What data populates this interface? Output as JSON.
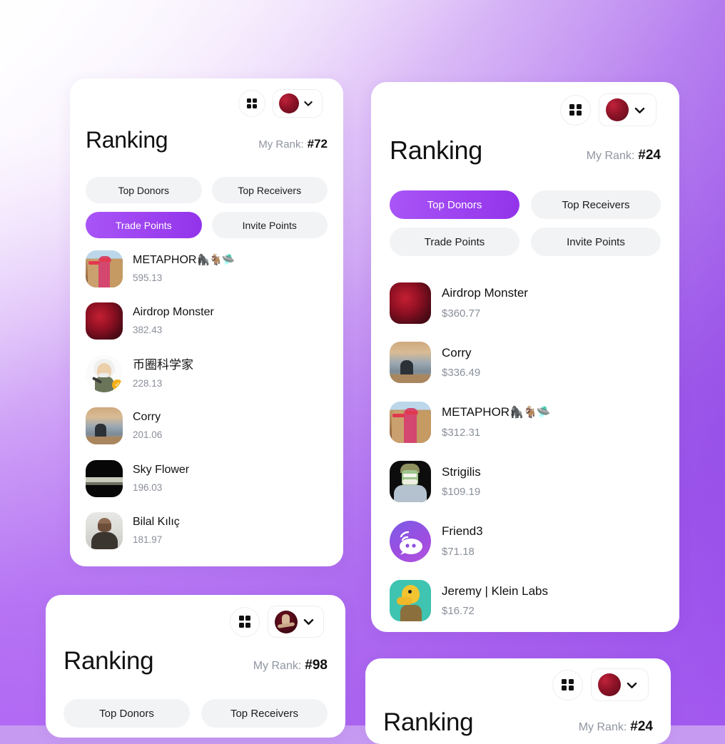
{
  "theme": {
    "accent": "#9333ea",
    "accent_light": "#a855f7",
    "pill_bg": "#f2f3f5",
    "text": "#111111",
    "muted": "#8a8f9a",
    "bg_from": "#fdfbff",
    "bg_to": "#b66ff5"
  },
  "cards": [
    {
      "id": "card-top-left",
      "title": "Ranking",
      "rank_label": "My Rank:",
      "rank_value": "#72",
      "grid_icon": "grid-icon",
      "chevron_icon": "chevron-down-icon",
      "avatar_name": "account-avatar",
      "tabs": [
        {
          "label": "Top Donors",
          "active": false
        },
        {
          "label": "Top Receivers",
          "active": false
        },
        {
          "label": "Trade Points",
          "active": true
        },
        {
          "label": "Invite Points",
          "active": false
        }
      ],
      "rows": [
        {
          "name": "METAPHOR",
          "emoji": "🦍🐐🛸",
          "score": "595.13",
          "avatar": "apes-avatar",
          "verified": false
        },
        {
          "name": "Airdrop Monster",
          "emoji": "",
          "score": "382.43",
          "avatar": "red-monster-avatar",
          "verified": false
        },
        {
          "name": "币圈科学家",
          "emoji": "",
          "score": "228.13",
          "avatar": "einstein-avatar",
          "verified": true
        },
        {
          "name": "Corry",
          "emoji": "",
          "score": "201.06",
          "avatar": "photographer-avatar",
          "verified": false
        },
        {
          "name": "Sky Flower",
          "emoji": "",
          "score": "196.03",
          "avatar": "dark-landscape-avatar",
          "verified": false
        },
        {
          "name": "Bilal Kılıç",
          "emoji": "",
          "score": "181.97",
          "avatar": "man-photo-avatar",
          "verified": false
        }
      ]
    },
    {
      "id": "card-top-right",
      "title": "Ranking",
      "rank_label": "My Rank:",
      "rank_value": "#24",
      "grid_icon": "grid-icon",
      "chevron_icon": "chevron-down-icon",
      "avatar_name": "account-avatar",
      "tabs": [
        {
          "label": "Top Donors",
          "active": true
        },
        {
          "label": "Top Receivers",
          "active": false
        },
        {
          "label": "Trade Points",
          "active": false
        },
        {
          "label": "Invite Points",
          "active": false
        }
      ],
      "rows": [
        {
          "name": "Airdrop Monster",
          "emoji": "",
          "score": "$360.77",
          "avatar": "red-monster-avatar",
          "verified": false
        },
        {
          "name": "Corry",
          "emoji": "",
          "score": "$336.49",
          "avatar": "photographer-avatar",
          "verified": false
        },
        {
          "name": "METAPHOR",
          "emoji": "🦍🐐🛸",
          "score": "$312.31",
          "avatar": "apes-avatar",
          "verified": false
        },
        {
          "name": "Strigilis",
          "emoji": "",
          "score": "$109.19",
          "avatar": "cartoon-green-avatar",
          "verified": false
        },
        {
          "name": "Friend3",
          "emoji": "",
          "score": "$71.18",
          "avatar": "friend3-logo-avatar",
          "verified": false
        },
        {
          "name": "Jeremy | Klein Labs",
          "emoji": "",
          "score": "$16.72",
          "avatar": "duck-avatar",
          "verified": false
        }
      ]
    },
    {
      "id": "card-bottom-left",
      "title": "Ranking",
      "rank_label": "My Rank:",
      "rank_value": "#98",
      "grid_icon": "grid-icon",
      "chevron_icon": "chevron-down-icon",
      "avatar_name": "account-avatar",
      "tabs": [
        {
          "label": "Top Donors",
          "active": false
        },
        {
          "label": "Top Receivers",
          "active": false
        }
      ],
      "rows": []
    },
    {
      "id": "card-bottom-right",
      "title": "Ranking",
      "rank_label": "My Rank:",
      "rank_value": "#24",
      "grid_icon": "grid-icon",
      "chevron_icon": "chevron-down-icon",
      "avatar_name": "account-avatar",
      "tabs": [],
      "rows": []
    }
  ]
}
